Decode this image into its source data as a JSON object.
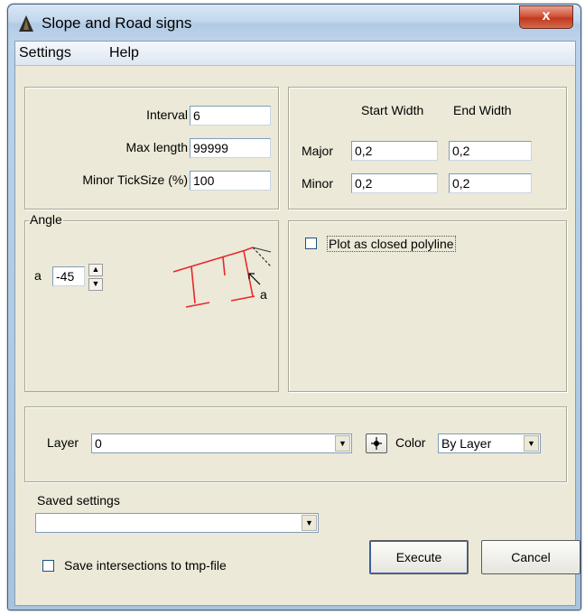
{
  "window": {
    "title": "Slope and Road signs",
    "close_label": "x"
  },
  "menu": {
    "items": [
      "Settings",
      "Help"
    ]
  },
  "interval": {
    "label": "Interval",
    "value": "6"
  },
  "max_length": {
    "label": "Max length",
    "value": "99999"
  },
  "minor_ticksize": {
    "label": "Minor TickSize (%)",
    "value": "100"
  },
  "widths": {
    "start_header": "Start Width",
    "end_header": "End Width",
    "major": {
      "label": "Major",
      "start": "0,2",
      "end": "0,2"
    },
    "minor": {
      "label": "Minor",
      "start": "0,2",
      "end": "0,2"
    }
  },
  "angle": {
    "legend": "Angle",
    "label": "a",
    "value": "-45",
    "diagram_label": "a",
    "diagram_color": "#e8282c"
  },
  "plot_closed": {
    "label": "Plot as closed polyline",
    "checked": false
  },
  "layer": {
    "label": "Layer",
    "value": "0",
    "pick_icon": "crosshair-icon"
  },
  "color": {
    "label": "Color",
    "value": "By Layer"
  },
  "saved_settings": {
    "label": "Saved settings",
    "value": ""
  },
  "save_intersections": {
    "label": "Save intersections to tmp-file",
    "checked": false
  },
  "buttons": {
    "execute": "Execute",
    "cancel": "Cancel"
  }
}
